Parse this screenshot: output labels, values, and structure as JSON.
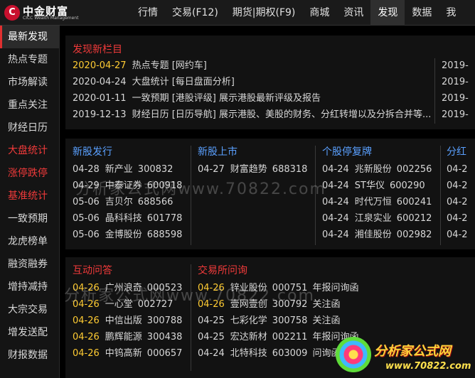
{
  "logo": {
    "mark": "C",
    "cn": "中金财富",
    "en": "CICC Wealth Management"
  },
  "nav": [
    "行情",
    "交易(F12)",
    "期货|期权(F9)",
    "商城",
    "资讯",
    "发现",
    "数据",
    "我"
  ],
  "sidebar": [
    "最新发现",
    "热点专题",
    "市场解读",
    "重点关注",
    "财经日历",
    "大盘统计",
    "涨停跌停",
    "基准统计",
    "一致预期",
    "龙虎榜单",
    "融资融券",
    "增持减持",
    "大宗交易",
    "增发送配",
    "财报数据"
  ],
  "discover": {
    "title": "发现新栏目",
    "rows": [
      {
        "date": "2020-04-27",
        "text": "热点专题 [网约车]"
      },
      {
        "date": "2020-04-24",
        "text": "大盘统计 [每日盘面分析]"
      },
      {
        "date": "2020-01-11",
        "text": "一致预期 [港股评级]  展示港股最新评级及报告"
      },
      {
        "date": "2019-12-13",
        "text": "财经日历 [日历导航]  展示港股、美股的财务、分红转增以及分拆合并等..."
      }
    ],
    "right": [
      "2019-",
      "2019-",
      "2019-",
      "2019-"
    ]
  },
  "ipo": {
    "title": "新股发行",
    "rows": [
      {
        "date": "04-28",
        "name": "新产业",
        "code": "300832"
      },
      {
        "date": "04-29",
        "name": "中泰证券",
        "code": "600918"
      },
      {
        "date": "05-06",
        "name": "吉贝尔",
        "code": "688566"
      },
      {
        "date": "05-06",
        "name": "晶科科技",
        "code": "601778"
      },
      {
        "date": "05-06",
        "name": "金博股份",
        "code": "688598"
      }
    ]
  },
  "listing": {
    "title": "新股上市",
    "rows": [
      {
        "date": "04-27",
        "name": "财富趋势",
        "code": "688318"
      }
    ]
  },
  "suspend": {
    "title": "个股停复牌",
    "rows": [
      {
        "date": "04-24",
        "name": "兆新股份",
        "code": "002256"
      },
      {
        "date": "04-24",
        "name": "ST华仪",
        "code": "600290"
      },
      {
        "date": "04-24",
        "name": "时代万恒",
        "code": "600241"
      },
      {
        "date": "04-24",
        "name": "江泉实业",
        "code": "600212"
      },
      {
        "date": "04-24",
        "name": "湘佳股份",
        "code": "002982"
      }
    ]
  },
  "dividend": {
    "title": "分红",
    "rows": [
      "04-2",
      "04-2",
      "04-2",
      "04-2",
      "04-2"
    ]
  },
  "interact": {
    "title": "互动问答",
    "rows": [
      {
        "date": "04-26",
        "name": "广州浪奇",
        "code": "000523"
      },
      {
        "date": "04-26",
        "name": "一心堂",
        "code": "002727"
      },
      {
        "date": "04-26",
        "name": "中信出版",
        "code": "300788"
      },
      {
        "date": "04-26",
        "name": "鹏辉能源",
        "code": "300438"
      },
      {
        "date": "04-26",
        "name": "中钨高新",
        "code": "000657"
      }
    ]
  },
  "inquiry": {
    "title": "交易所问询",
    "rows": [
      {
        "date": "04-26",
        "name": "锌业股份",
        "code": "000751",
        "type": "年报问询函"
      },
      {
        "date": "04-26",
        "name": "壹网壹创",
        "code": "300792",
        "type": "关注函"
      },
      {
        "date": "04-25",
        "name": "七彩化学",
        "code": "300758",
        "type": "关注函"
      },
      {
        "date": "04-25",
        "name": "宏达新材",
        "code": "002211",
        "type": "年报问询函"
      },
      {
        "date": "04-24",
        "name": "北特科技",
        "code": "603009",
        "type": "问询函"
      }
    ]
  },
  "watermark": {
    "top": "分析家公式网www.70822.com",
    "bottom": "分析家公式网www.70822.com"
  },
  "badge": {
    "t1": "分析家公式网",
    "t2": "www.70822.com"
  },
  "colors": {
    "accent_red": "#f03a3a",
    "link_blue": "#5aa0ff",
    "date_yellow": "#ffcc33"
  }
}
